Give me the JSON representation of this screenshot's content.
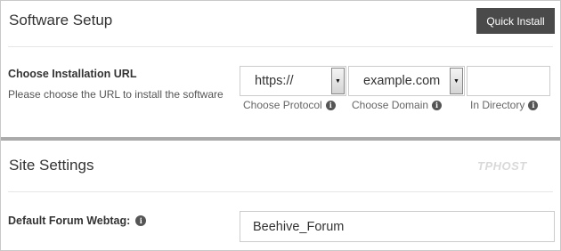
{
  "software_setup": {
    "title": "Software Setup",
    "quick_install_label": "Quick Install",
    "install_url": {
      "label": "Choose Installation URL",
      "description": "Please choose the URL to install the software",
      "protocol": {
        "value": "https://",
        "hint": "Choose Protocol"
      },
      "domain": {
        "value": "example.com",
        "hint": "Choose Domain"
      },
      "directory": {
        "value": "",
        "hint": "In Directory"
      }
    }
  },
  "site_settings": {
    "title": "Site Settings",
    "watermark": "TPHOST",
    "forum_webtag": {
      "label": "Default Forum Webtag:",
      "value": "Beehive_Forum"
    }
  },
  "icons": {
    "info": "info-icon",
    "dropdown": "triangle-down-icon"
  }
}
